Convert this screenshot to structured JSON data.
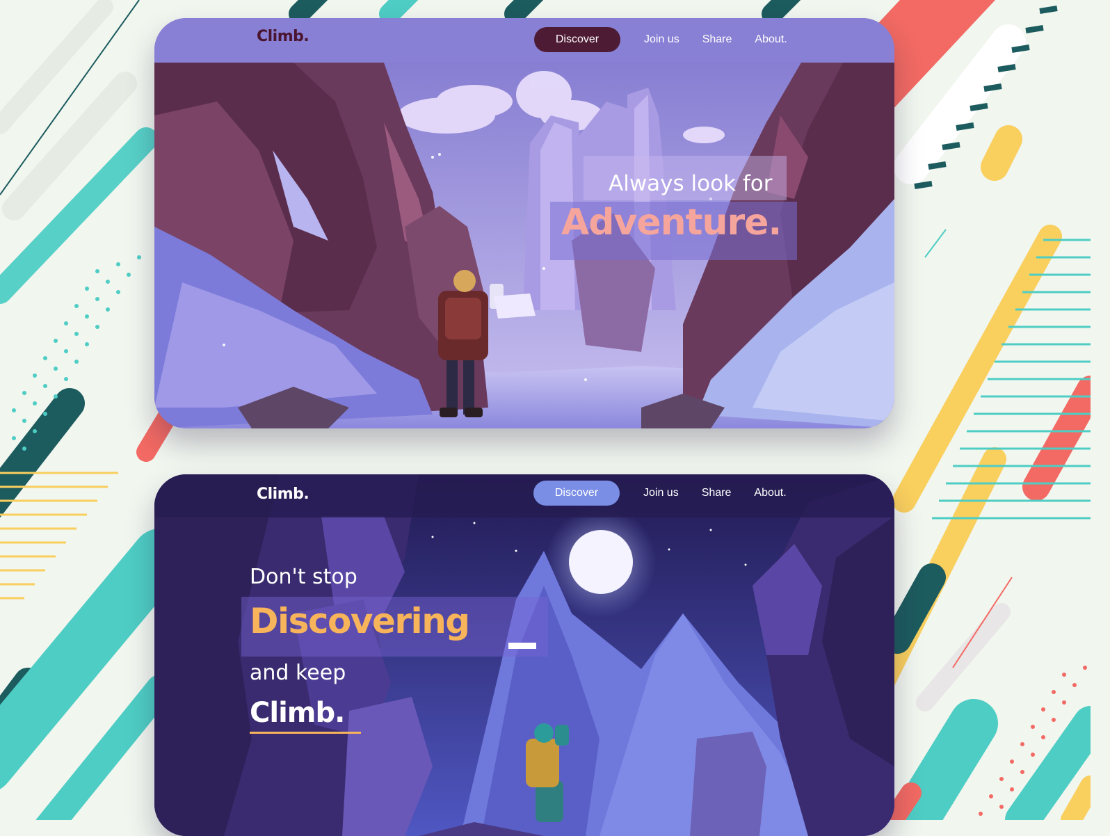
{
  "colors": {
    "teal": "#4ecdc4",
    "dark_teal": "#1c5b5e",
    "coral": "#f26a63",
    "yellow": "#f9cf5e",
    "day_nav": "#8880d4",
    "night_nav": "#261c52",
    "adventure": "#f6a59c",
    "discovering": "#f7b45a"
  },
  "day_card": {
    "logo": "Climb.",
    "nav": {
      "discover": "Discover",
      "join": "Join us",
      "share": "Share",
      "about": "About."
    },
    "hero": {
      "line1": "Always look for",
      "line2": "Adventure."
    }
  },
  "night_card": {
    "logo": "Climb.",
    "nav": {
      "discover": "Discover",
      "join": "Join us",
      "share": "Share",
      "about": "About."
    },
    "hero": {
      "line1": "Don't stop",
      "line2": "Discovering",
      "line3": "and keep",
      "line4": "Climb."
    }
  }
}
